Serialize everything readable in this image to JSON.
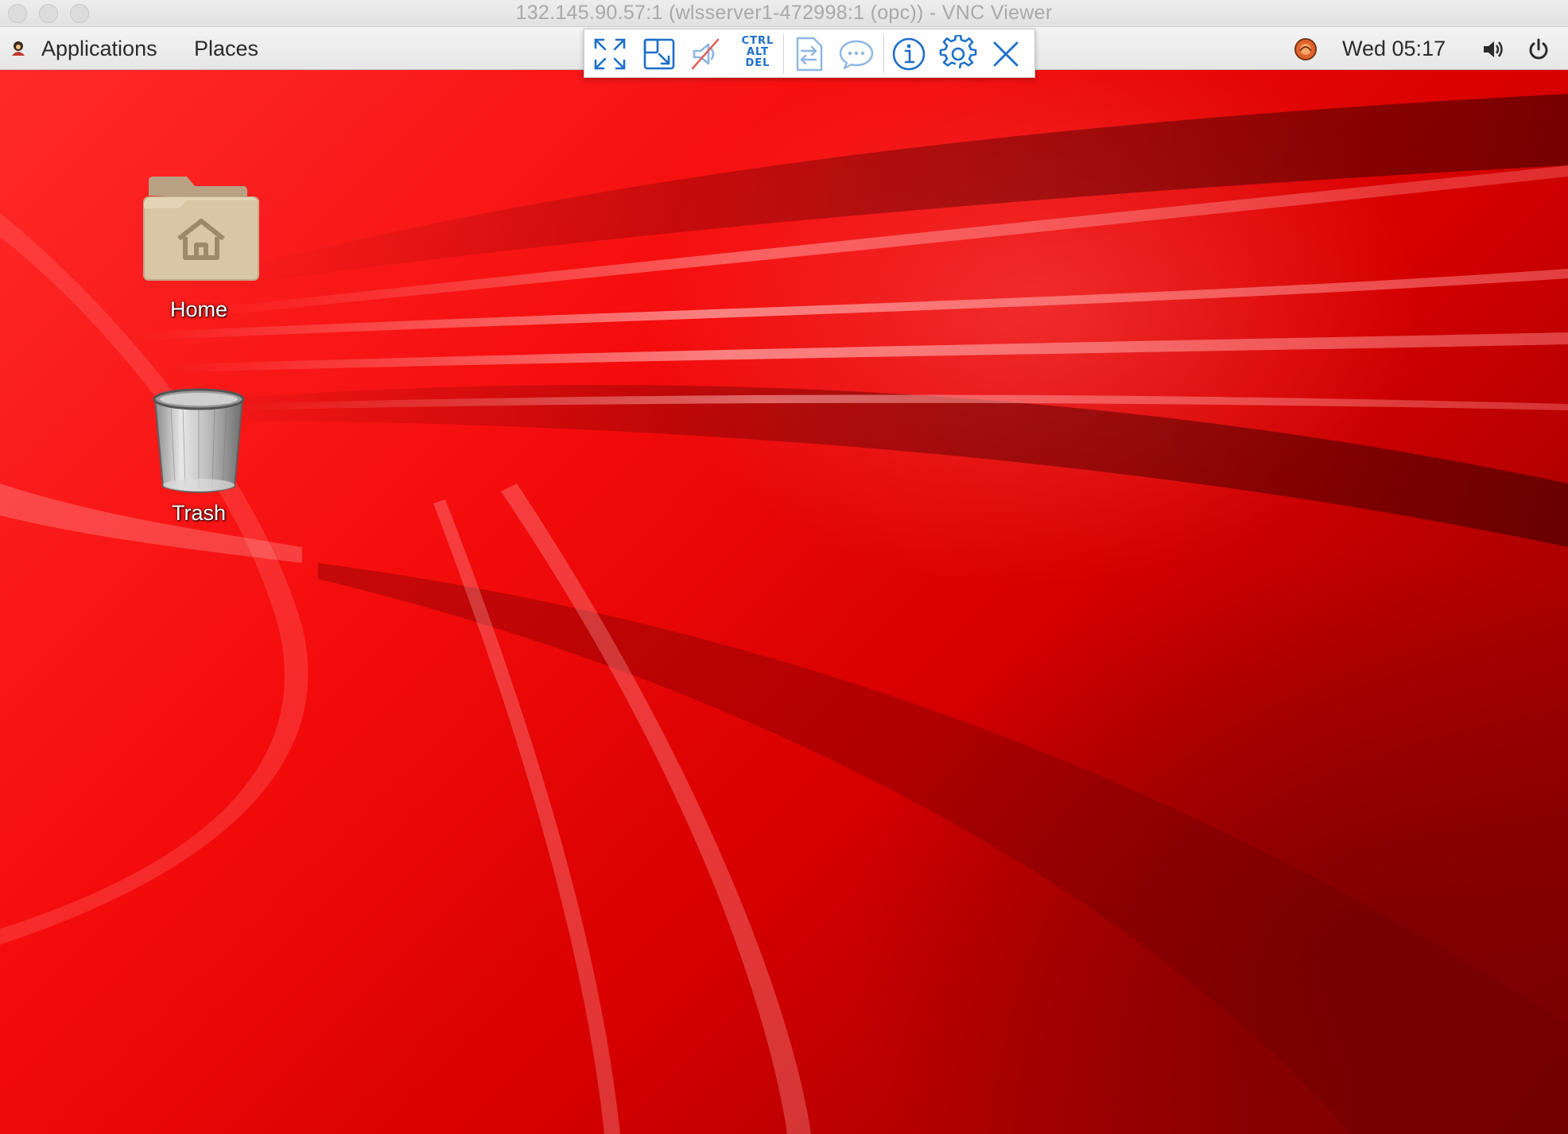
{
  "window": {
    "title": "132.145.90.57:1 (wlsserver1-472998:1 (opc)) - VNC Viewer"
  },
  "panel": {
    "applications_label": "Applications",
    "places_label": "Places",
    "clock": "Wed 05:17",
    "icons": [
      "user-menu-icon",
      "network-status-icon",
      "volume-icon",
      "power-icon"
    ]
  },
  "vnc_toolbar": {
    "buttons": [
      "fullscreen-icon",
      "scale-to-fit-icon",
      "disable-audio-icon",
      "ctrl-alt-del-icon",
      "file-transfer-icon",
      "chat-icon",
      "info-icon",
      "settings-icon",
      "close-icon"
    ],
    "cad_lines": [
      "CTRL",
      "ALT",
      "DEL"
    ],
    "accent_color": "#1d6fc9"
  },
  "desktop": {
    "icons": [
      {
        "label": "Home",
        "icon": "home-folder-icon"
      },
      {
        "label": "Trash",
        "icon": "trash-icon"
      }
    ],
    "wallpaper_color": "#e00000"
  }
}
